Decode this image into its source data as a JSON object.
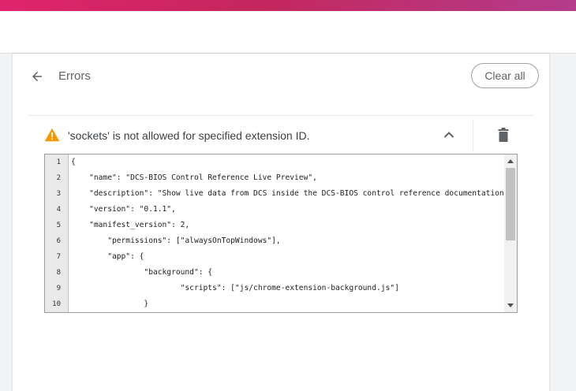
{
  "header": {
    "title": "Errors",
    "clear_all_label": "Clear all"
  },
  "error": {
    "message": "'sockets' is not allowed for specified extension ID."
  },
  "code": {
    "line_numbers": [
      "1",
      "2",
      "3",
      "4",
      "5",
      "6",
      "7",
      "8",
      "9",
      "10"
    ],
    "lines": [
      "{",
      "    \"name\": \"DCS-BIOS Control Reference Live Preview\",",
      "    \"description\": \"Show live data from DCS inside the DCS-BIOS control reference documentation",
      "    \"version\": \"0.1.1\",",
      "    \"manifest_version\": 2,",
      "        \"permissions\": [\"alwaysOnTopWindows\"],",
      "        \"app\": {",
      "                \"background\": {",
      "                        \"scripts\": [\"js/chrome-extension-background.js\"]",
      "                }"
    ]
  },
  "colors": {
    "warning": "#f29900",
    "accent_stripe": "#e0246b"
  },
  "icons": {
    "back": "arrow-back-icon",
    "warning": "warning-icon",
    "collapse": "chevron-up-icon",
    "delete": "trash-icon"
  }
}
